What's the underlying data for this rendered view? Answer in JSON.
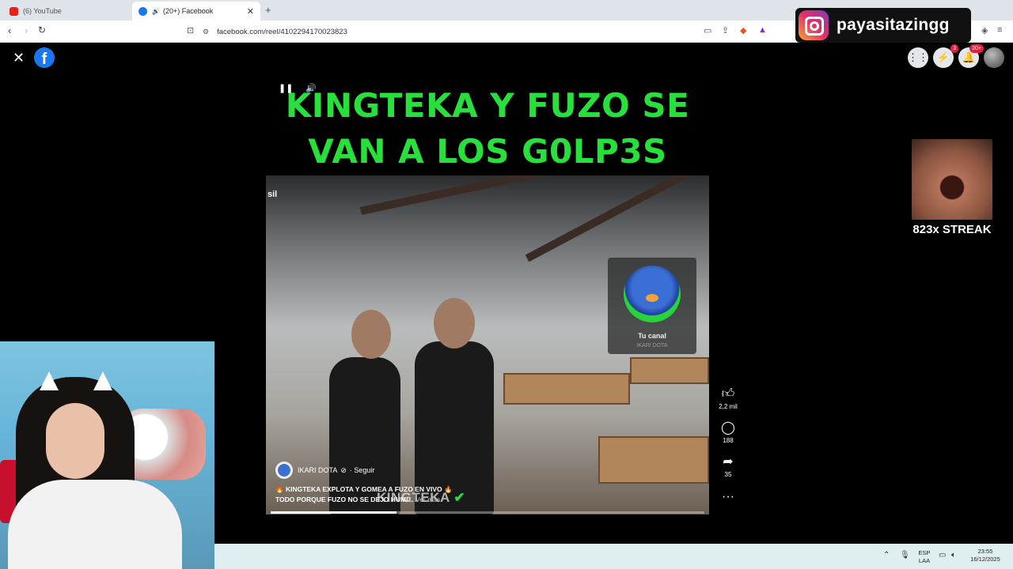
{
  "browser": {
    "tabs": [
      {
        "label": "(6) YouTube",
        "icon": "youtube-icon",
        "active": false
      },
      {
        "label": "(20+) Facebook",
        "icon": "facebook-icon",
        "active": true
      }
    ],
    "url": "facebook.com/reel/4102294170023823"
  },
  "overlay": {
    "instagram_handle": "payasitazingg",
    "streak_label": "823x STREAK"
  },
  "facebook": {
    "messenger_badge": "3",
    "notifications_badge": "20+",
    "reel": {
      "title_line1": "KINGTEKA Y FUZO SE",
      "title_line2": "VAN A LOS G0LP3S",
      "video_corner_text": "sil",
      "channel_card": {
        "name": "Tu canal",
        "sub": "IKARI DOTA"
      },
      "author": "IKARI DOTA",
      "author_suffix": "· Seguir",
      "caption_line1": "🔥 KINGTEKA EXPLOTA Y GOMEA A FUZO EN VIVO 🔥",
      "caption_line2": "TODO PORQUE FUZO NO SE DEJO HUMI...",
      "caption_more": "Ver más",
      "watermark": "KINGTEKA",
      "progress": 0.29
    },
    "actions": {
      "likes": "2,2 mil",
      "comments": "188",
      "shares": "35"
    }
  },
  "taskbar": {
    "lang_line1": "ESP",
    "lang_line2": "LAA",
    "time": "23:55",
    "date": "16/12/2025"
  },
  "colors": {
    "title_green": "#27e03c",
    "facebook_blue": "#1877f2",
    "badge_red": "#e41e3f"
  }
}
